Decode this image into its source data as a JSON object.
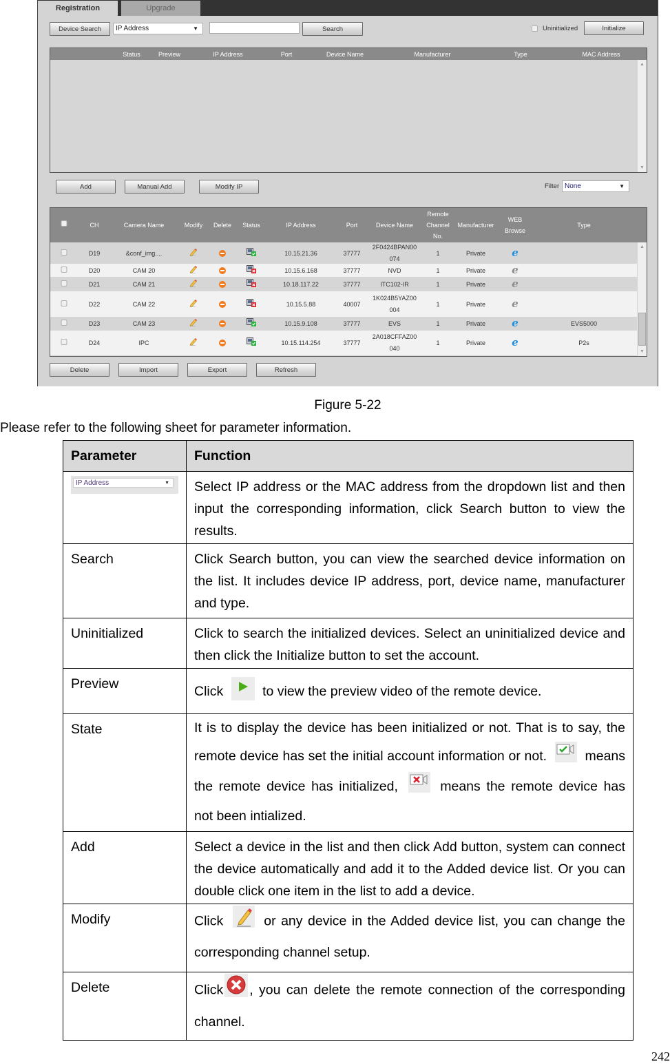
{
  "ui": {
    "tabs": [
      {
        "label": "Registration",
        "active": true
      },
      {
        "label": "Upgrade",
        "active": false
      }
    ],
    "search_bar": {
      "device_search_label": "Device Search",
      "search_type_selected": "IP Address",
      "search_input_value": "",
      "search_label": "Search",
      "uninitialized_label": "Uninitialized",
      "uninitialized_checked": false,
      "initialize_label": "Initialize"
    },
    "search_results": {
      "columns": [
        "Status",
        "Preview",
        "IP Address",
        "Port",
        "Device Name",
        "Manufacturer",
        "Type",
        "MAC Address"
      ],
      "rows": []
    },
    "action_buttons": {
      "add_label": "Add",
      "manual_add_label": "Manual Add",
      "modify_ip_label": "Modify IP",
      "filter_label": "Filter",
      "filter_selected": "None"
    },
    "added_devices": {
      "columns": [
        "CH",
        "Camera Name",
        "Modify",
        "Delete",
        "Status",
        "IP Address",
        "Port",
        "Device Name",
        "Remote Channel No.",
        "Manufacturer",
        "WEB Browse",
        "Type"
      ],
      "column_lines": {
        "remote_channel": [
          "Remote",
          "Channel",
          "No."
        ],
        "web_browse": [
          "WEB",
          "Browse"
        ]
      },
      "rows": [
        {
          "ch": "D19",
          "camera_name": "&conf_img....",
          "status": "initialized",
          "ip": "10.15.21.36",
          "port": "37777",
          "device_name": [
            "2F0424BPAN00",
            "074"
          ],
          "remote_channel": "1",
          "manufacturer": "Private",
          "web_browse_active": true,
          "type": ""
        },
        {
          "ch": "D20",
          "camera_name": "CAM 20",
          "status": "uninitialized",
          "ip": "10.15.6.168",
          "port": "37777",
          "device_name": [
            "NVD"
          ],
          "remote_channel": "1",
          "manufacturer": "Private",
          "web_browse_active": false,
          "type": ""
        },
        {
          "ch": "D21",
          "camera_name": "CAM 21",
          "status": "uninitialized",
          "ip": "10.18.117.22",
          "port": "37777",
          "device_name": [
            "ITC102-IR"
          ],
          "remote_channel": "1",
          "manufacturer": "Private",
          "web_browse_active": false,
          "type": ""
        },
        {
          "ch": "D22",
          "camera_name": "CAM 22",
          "status": "uninitialized",
          "ip": "10.15.5.88",
          "port": "40007",
          "device_name": [
            "1K024B5YAZ00",
            "004"
          ],
          "remote_channel": "1",
          "manufacturer": "Private",
          "web_browse_active": false,
          "type": ""
        },
        {
          "ch": "D23",
          "camera_name": "CAM 23",
          "status": "initialized",
          "ip": "10.15.9.108",
          "port": "37777",
          "device_name": [
            "EVS"
          ],
          "remote_channel": "1",
          "manufacturer": "Private",
          "web_browse_active": true,
          "type": "EVS5000"
        },
        {
          "ch": "D24",
          "camera_name": "IPC",
          "status": "initialized",
          "ip": "10.15.114.254",
          "port": "37777",
          "device_name": [
            "2A018CFFAZ00",
            "040"
          ],
          "remote_channel": "1",
          "manufacturer": "Private",
          "web_browse_active": true,
          "type": "P2s"
        }
      ]
    },
    "bottom_buttons": {
      "delete_label": "Delete",
      "import_label": "Import",
      "export_label": "Export",
      "refresh_label": "Refresh"
    },
    "colors": {
      "ie_active": "#1e8fdc",
      "ie_inactive": "#8a8a8a",
      "status_ok": "#27b33c",
      "status_bad": "#d9202a",
      "delete_icon": "#f07a1c"
    }
  },
  "document": {
    "figure_caption": "Figure 5-22",
    "intro": "Please refer to the following sheet for parameter information.",
    "table": {
      "headers": [
        "Parameter",
        "Function"
      ],
      "rows": [
        {
          "parameter": "",
          "parameter_icon": "ip-address-dropdown",
          "parameter_icon_text": "IP Address",
          "function": [
            "Select IP address or the MAC address from the dropdown list and then input the corresponding information, click Search button to view the results."
          ]
        },
        {
          "parameter": "Search",
          "function": [
            "Click Search button, you can view the searched device information on the list. It includes device IP address, port, device name, manufacturer and type."
          ]
        },
        {
          "parameter": "Uninitialized",
          "function": [
            "Click to search the initialized devices. Select an uninitialized device and then click the Initialize button to set the account."
          ]
        },
        {
          "parameter": "Preview",
          "function": [
            "Click",
            "to view the preview video of the remote device."
          ]
        },
        {
          "parameter": "State",
          "function": [
            "It is to display the device has been initialized or not. That is to say, the remote device has set the initial account information or not.",
            "means the remote device has initialized,",
            "means the remote device has not been intialized."
          ]
        },
        {
          "parameter": "Add",
          "function": [
            "Select a device in the list and then click Add button, system can connect the device automatically and add it to the Added device list. Or you can double click one item in the list to add a device."
          ]
        },
        {
          "parameter": "Modify",
          "function": [
            "Click",
            "or any device in the Added device list, you can change the corresponding channel setup."
          ]
        },
        {
          "parameter": "Delete",
          "function": [
            "Click",
            ", you can delete the remote connection of the corresponding channel."
          ]
        }
      ]
    },
    "page_number": "242"
  }
}
